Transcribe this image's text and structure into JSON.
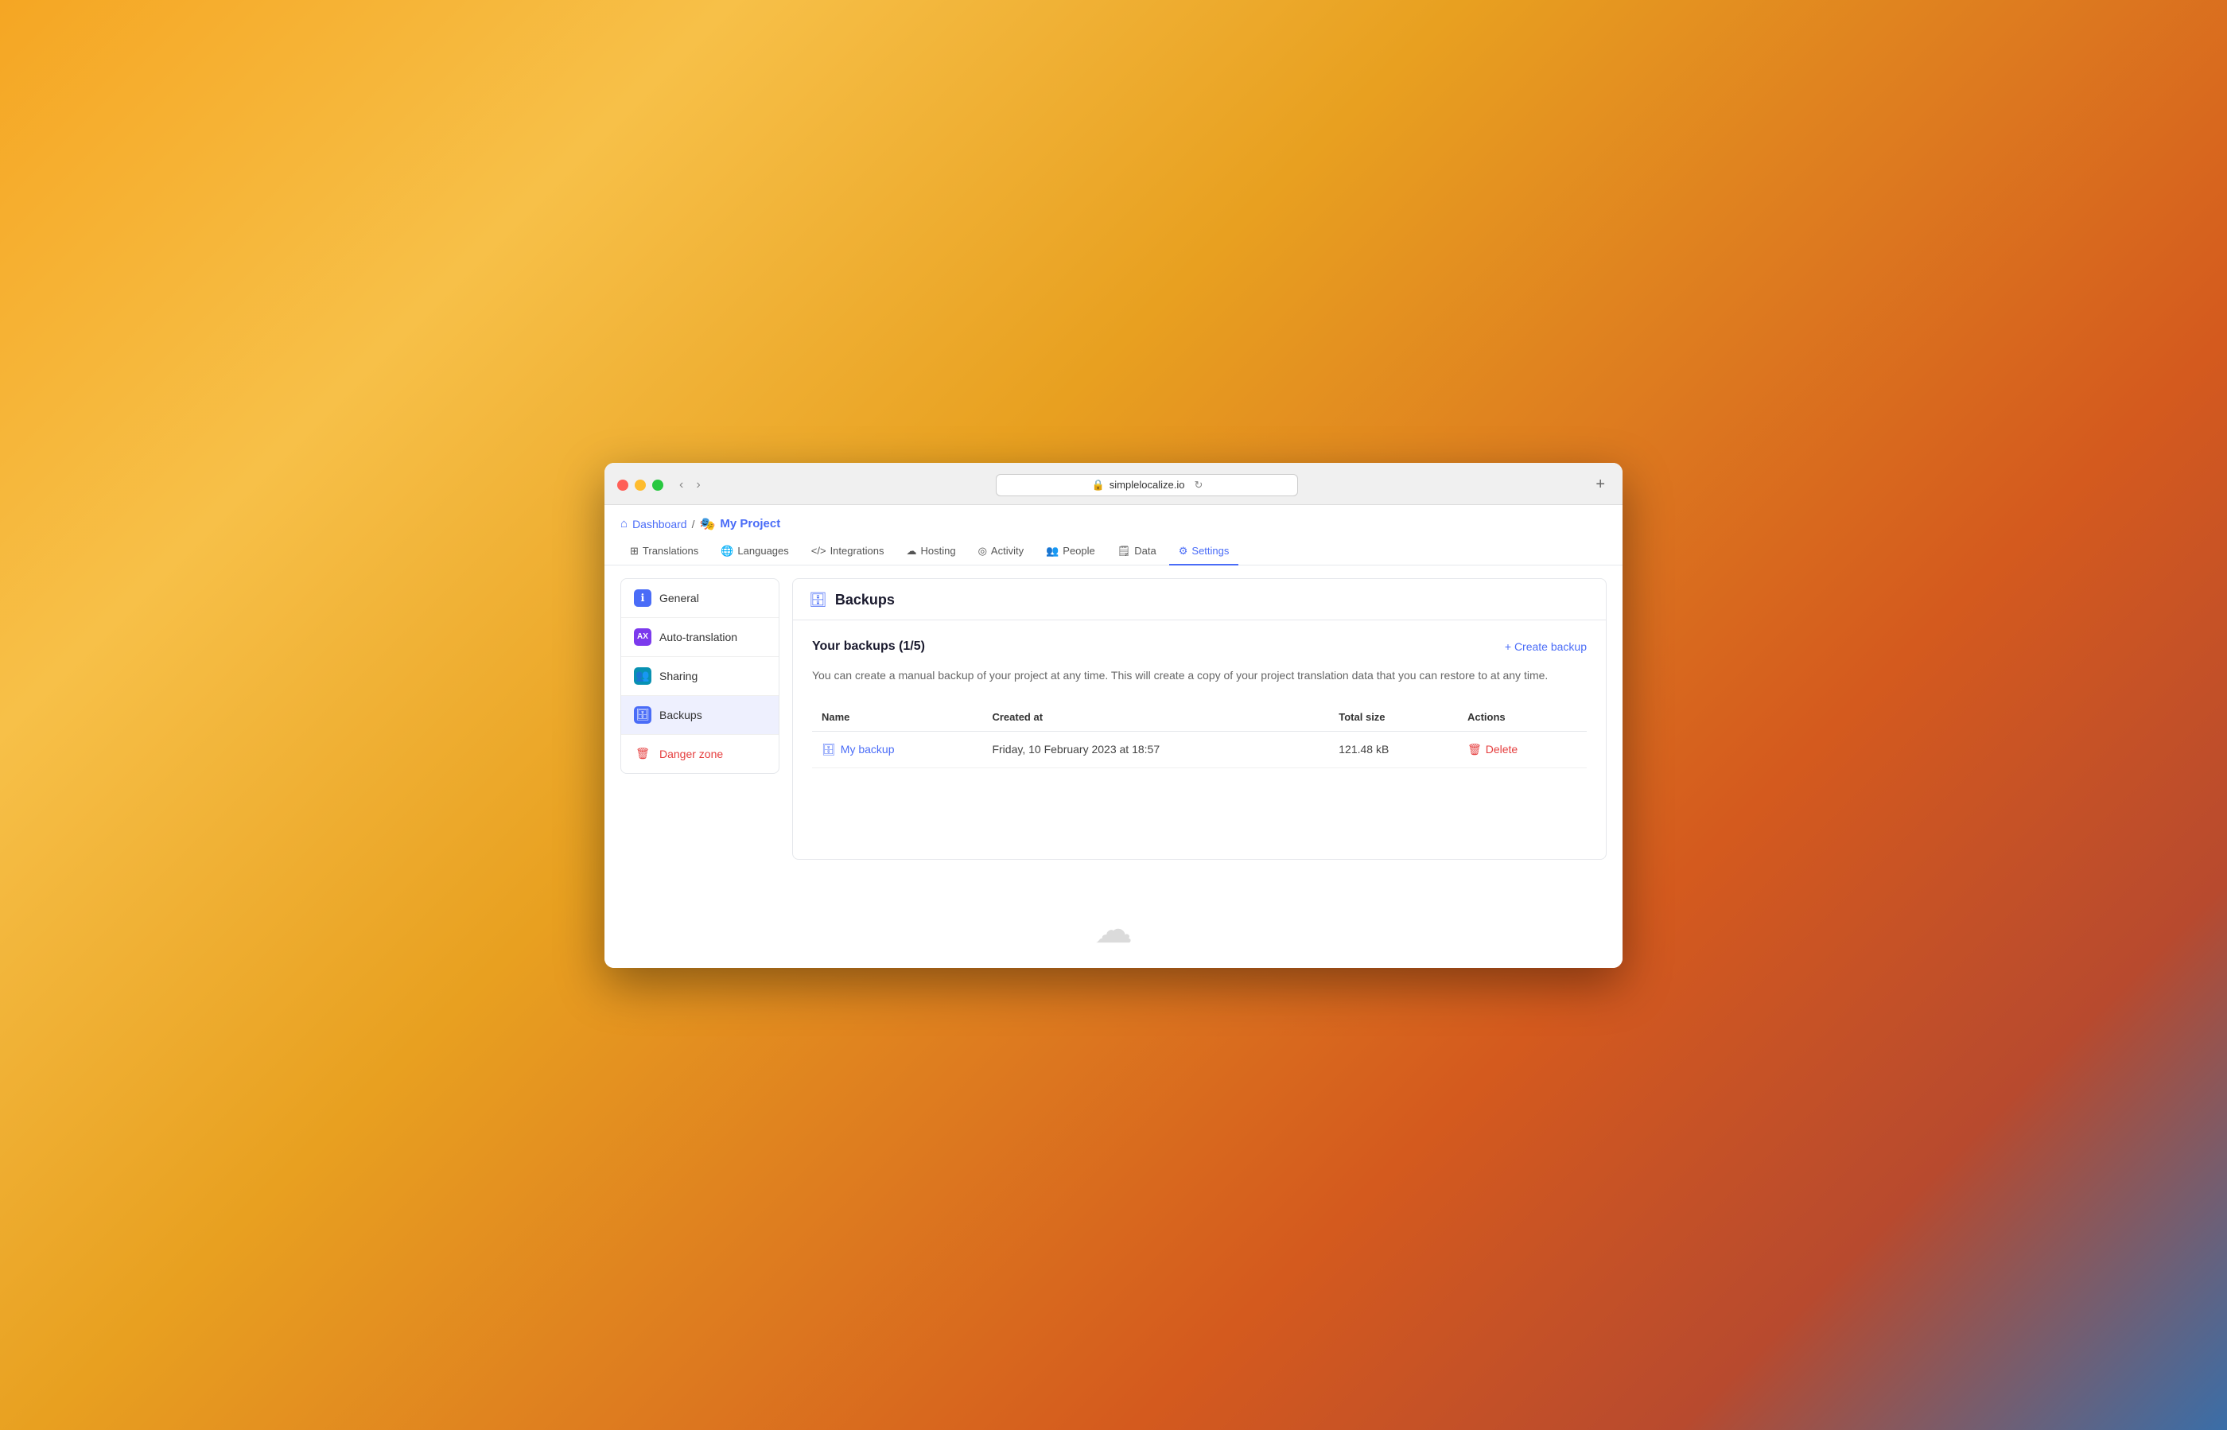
{
  "browser": {
    "url": "simplelocalize.io",
    "new_tab_label": "+"
  },
  "breadcrumb": {
    "home_label": "Dashboard",
    "separator": "/",
    "project_label": "My Project"
  },
  "top_nav": {
    "tabs": [
      {
        "id": "translations",
        "label": "Translations",
        "icon": "⊞",
        "active": false
      },
      {
        "id": "languages",
        "label": "Languages",
        "icon": "🌐",
        "active": false
      },
      {
        "id": "integrations",
        "label": "Integrations",
        "icon": "</>",
        "active": false
      },
      {
        "id": "hosting",
        "label": "Hosting",
        "icon": "☁",
        "active": false
      },
      {
        "id": "activity",
        "label": "Activity",
        "icon": "◎",
        "active": false
      },
      {
        "id": "people",
        "label": "People",
        "icon": "👥",
        "active": false
      },
      {
        "id": "data",
        "label": "Data",
        "icon": "🗒",
        "active": false
      },
      {
        "id": "settings",
        "label": "Settings",
        "icon": "⚙",
        "active": true
      }
    ]
  },
  "sidebar": {
    "items": [
      {
        "id": "general",
        "label": "General",
        "icon": "ℹ",
        "icon_class": "icon-blue",
        "active": false,
        "danger": false
      },
      {
        "id": "auto-translation",
        "label": "Auto-translation",
        "icon": "AX",
        "icon_class": "icon-purple",
        "active": false,
        "danger": false
      },
      {
        "id": "sharing",
        "label": "Sharing",
        "icon": "👥",
        "icon_class": "icon-teal",
        "active": false,
        "danger": false
      },
      {
        "id": "backups",
        "label": "Backups",
        "icon": "🗄",
        "icon_class": "icon-db",
        "active": true,
        "danger": false
      },
      {
        "id": "danger-zone",
        "label": "Danger zone",
        "icon": "🗑",
        "icon_class": "icon-red",
        "active": false,
        "danger": true
      }
    ]
  },
  "content": {
    "header_icon": "🗄",
    "header_title": "Backups",
    "backups_count_label": "Your backups (1/5)",
    "create_backup_label": "+ Create backup",
    "description": "You can create a manual backup of your project at any time. This will create a copy of your project translation data that you can restore to at any time.",
    "table": {
      "columns": [
        {
          "id": "name",
          "label": "Name"
        },
        {
          "id": "created_at",
          "label": "Created at"
        },
        {
          "id": "total_size",
          "label": "Total size"
        },
        {
          "id": "actions",
          "label": "Actions"
        }
      ],
      "rows": [
        {
          "name": "My backup",
          "created_at": "Friday, 10 February 2023 at 18:57",
          "total_size": "121.48 kB",
          "action_label": "Delete"
        }
      ]
    }
  }
}
